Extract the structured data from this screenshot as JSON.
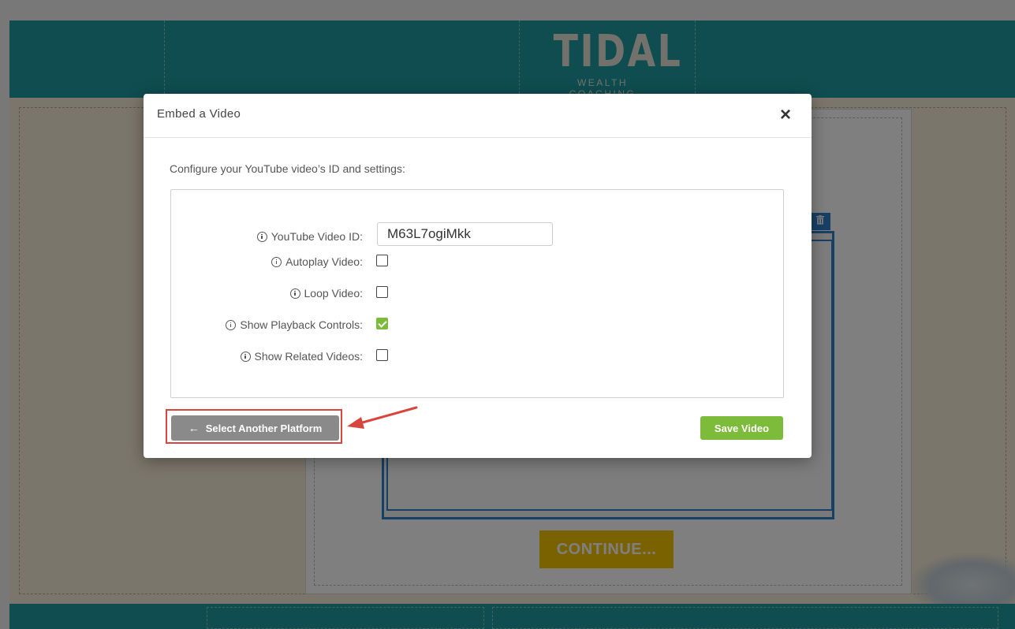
{
  "background": {
    "logo": {
      "word": "TIDAL",
      "subtitle": "WEALTH COACHING"
    },
    "continue_label": "CONTINUE...",
    "trash_icon": "trash-icon"
  },
  "modal": {
    "title": "Embed a Video",
    "close_label": "×",
    "description": "Configure your YouTube video’s ID and settings:",
    "fields": {
      "video_id_label": "YouTube Video ID:",
      "video_id_value": "M63L7ogiMkk",
      "autoplay_label": "Autoplay Video:",
      "autoplay_checked": false,
      "loop_label": "Loop Video:",
      "loop_checked": false,
      "controls_label": "Show Playback Controls:",
      "controls_checked": true,
      "related_label": "Show Related Videos:",
      "related_checked": false
    },
    "back_button": {
      "arrow": "←",
      "label": "Select Another Platform"
    },
    "save_button": "Save Video"
  },
  "colors": {
    "brand_teal": "#1f9aa0",
    "accent_green": "#7dbb3a",
    "annotation_red": "#d9453d",
    "continue_yellow": "#f5c400"
  }
}
